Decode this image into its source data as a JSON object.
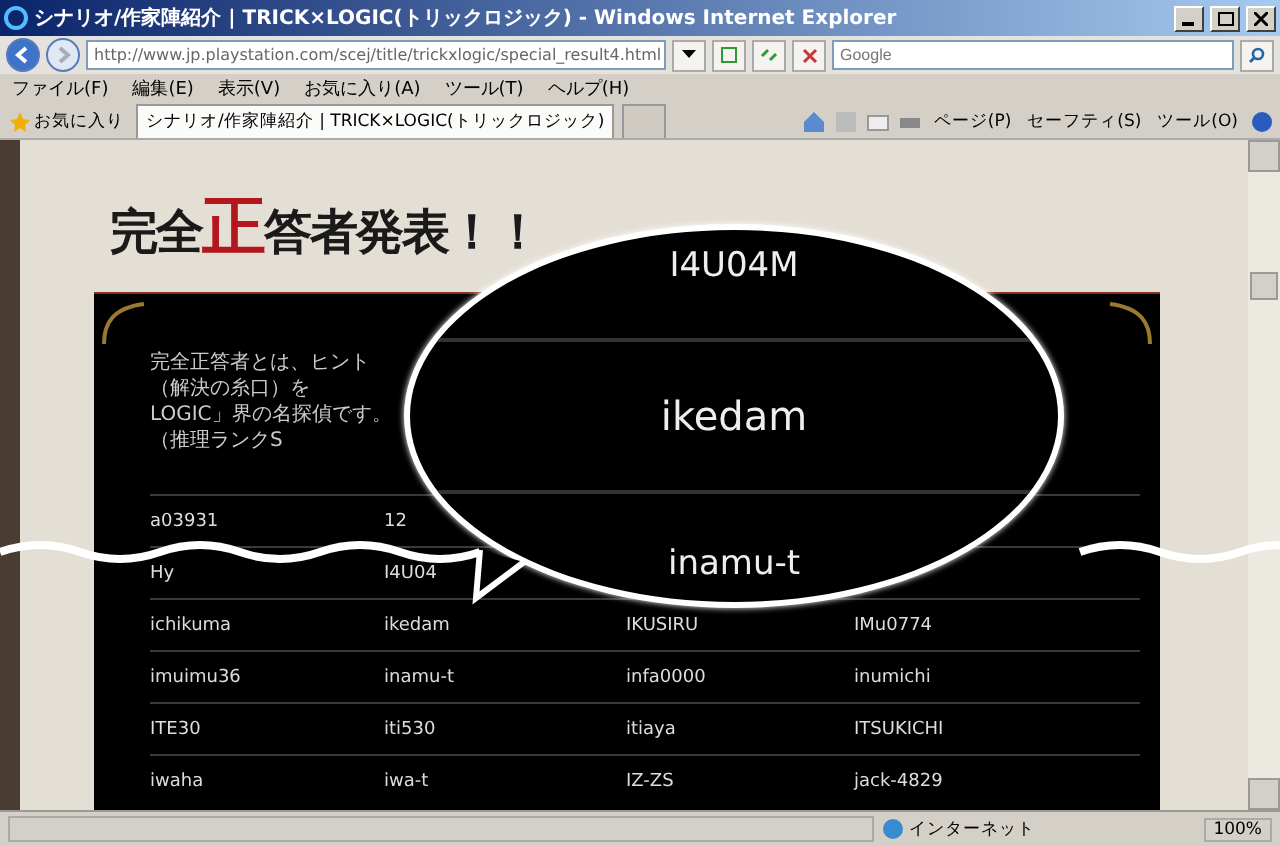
{
  "window": {
    "title": "シナリオ/作家陣紹介 | TRICK×LOGIC(トリックロジック) - Windows Internet Explorer"
  },
  "address_bar": {
    "url": "http://www.jp.playstation.com/scej/title/trickxlogic/special_result4.html"
  },
  "search": {
    "placeholder": "Google"
  },
  "menu": [
    "ファイル(F)",
    "編集(E)",
    "表示(V)",
    "お気に入り(A)",
    "ツール(T)",
    "ヘルプ(H)"
  ],
  "favorites": {
    "label": "お気に入り"
  },
  "tabs": [
    {
      "label": "シナリオ/作家陣紹介 | TRICK×LOGIC(トリックロジック)",
      "selected": true
    }
  ],
  "command_bar": [
    "ページ(P)",
    "セーフティ(S)",
    "ツール(O)"
  ],
  "page": {
    "heading": [
      {
        "text": "完全",
        "accent": false
      },
      {
        "text": "正",
        "accent": true
      },
      {
        "text": "答者発表！！",
        "accent": false
      }
    ],
    "intro": [
      "完全正答者とは、ヒント（解決の糸口）を",
      "LOGIC」界の名探偵です。（推理ランクS"
    ],
    "rows": [
      {
        "cells": [
          "a03931",
          "12"
        ]
      },
      {
        "cells": [
          "Hy",
          "I4U04"
        ]
      },
      {
        "cells": [
          "ichikuma",
          "ikedam",
          "IKUSIRU",
          "IMu0774"
        ]
      },
      {
        "cells": [
          "imuimu36",
          "inamu-t",
          "infa0000",
          "inumichi"
        ]
      },
      {
        "cells": [
          "ITE30",
          "iti530",
          "itiaya",
          "ITSUKICHI"
        ]
      },
      {
        "cells": [
          "iwaha",
          "iwa-t",
          "IZ-ZS",
          "jack-4829"
        ]
      }
    ]
  },
  "magnifier": {
    "lines": [
      "I4U04M",
      "ikedam",
      "inamu-t"
    ]
  },
  "status_bar": {
    "zone": "インターネット",
    "zoom": "100%"
  }
}
